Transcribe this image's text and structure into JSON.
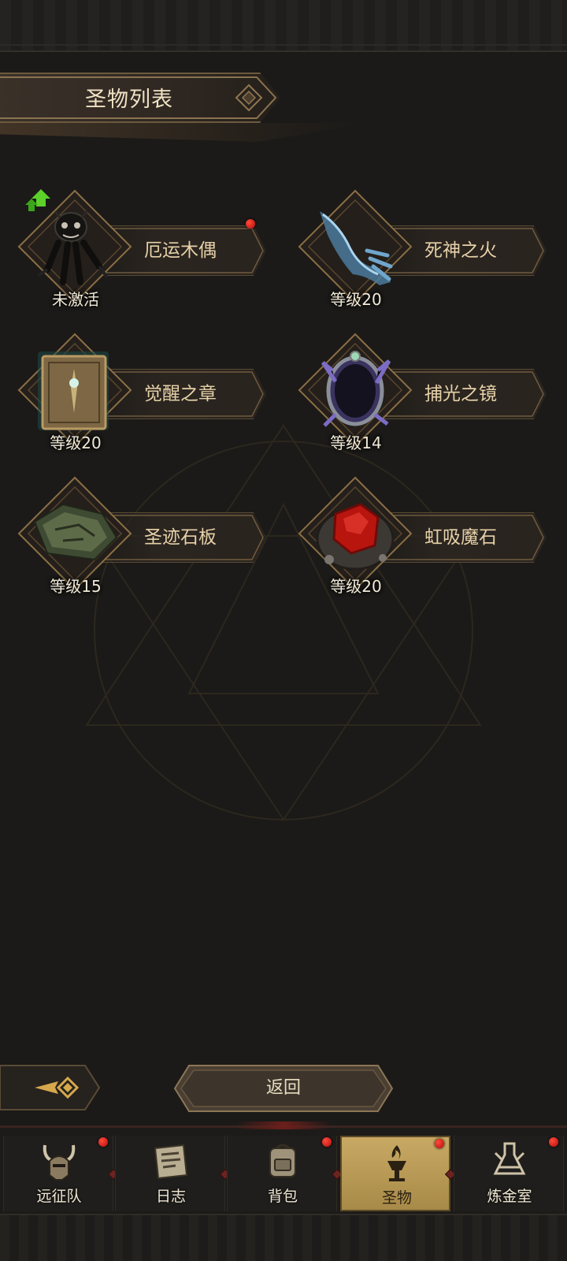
{
  "header": {
    "title": "圣物列表"
  },
  "relics": [
    {
      "name": "厄运木偶",
      "level_text": "未激活",
      "has_upgrade": true,
      "has_red_dot": true,
      "icon": "cursed-puppet-icon"
    },
    {
      "name": "死神之火",
      "level_text": "等级20",
      "has_upgrade": false,
      "has_red_dot": false,
      "icon": "reaper-fire-hand-icon"
    },
    {
      "name": "觉醒之章",
      "level_text": "等级20",
      "has_upgrade": false,
      "has_red_dot": false,
      "icon": "awakening-book-icon"
    },
    {
      "name": "捕光之镜",
      "level_text": "等级14",
      "has_upgrade": false,
      "has_red_dot": false,
      "icon": "light-catching-mirror-icon"
    },
    {
      "name": "圣迹石板",
      "level_text": "等级15",
      "has_upgrade": false,
      "has_red_dot": false,
      "icon": "miracle-stone-tablet-icon"
    },
    {
      "name": "虹吸魔石",
      "level_text": "等级20",
      "has_upgrade": false,
      "has_red_dot": false,
      "icon": "siphon-magic-stone-icon"
    }
  ],
  "footer": {
    "return_label": "返回"
  },
  "nav": {
    "tabs": [
      {
        "label": "远征队",
        "icon": "horned-helmet-icon",
        "has_red_dot": true,
        "active": false
      },
      {
        "label": "日志",
        "icon": "scroll-map-icon",
        "has_red_dot": false,
        "active": false
      },
      {
        "label": "背包",
        "icon": "backpack-icon",
        "has_red_dot": true,
        "active": false
      },
      {
        "label": "圣物",
        "icon": "torch-brazier-icon",
        "has_red_dot": true,
        "active": true
      },
      {
        "label": "炼金室",
        "icon": "alchemy-flask-icon",
        "has_red_dot": true,
        "active": false
      }
    ]
  },
  "colors": {
    "background": "#1b1a18",
    "gold_accent": "#c8a964",
    "text_light": "#e6d1a8",
    "notification_red": "#d11a1a"
  }
}
